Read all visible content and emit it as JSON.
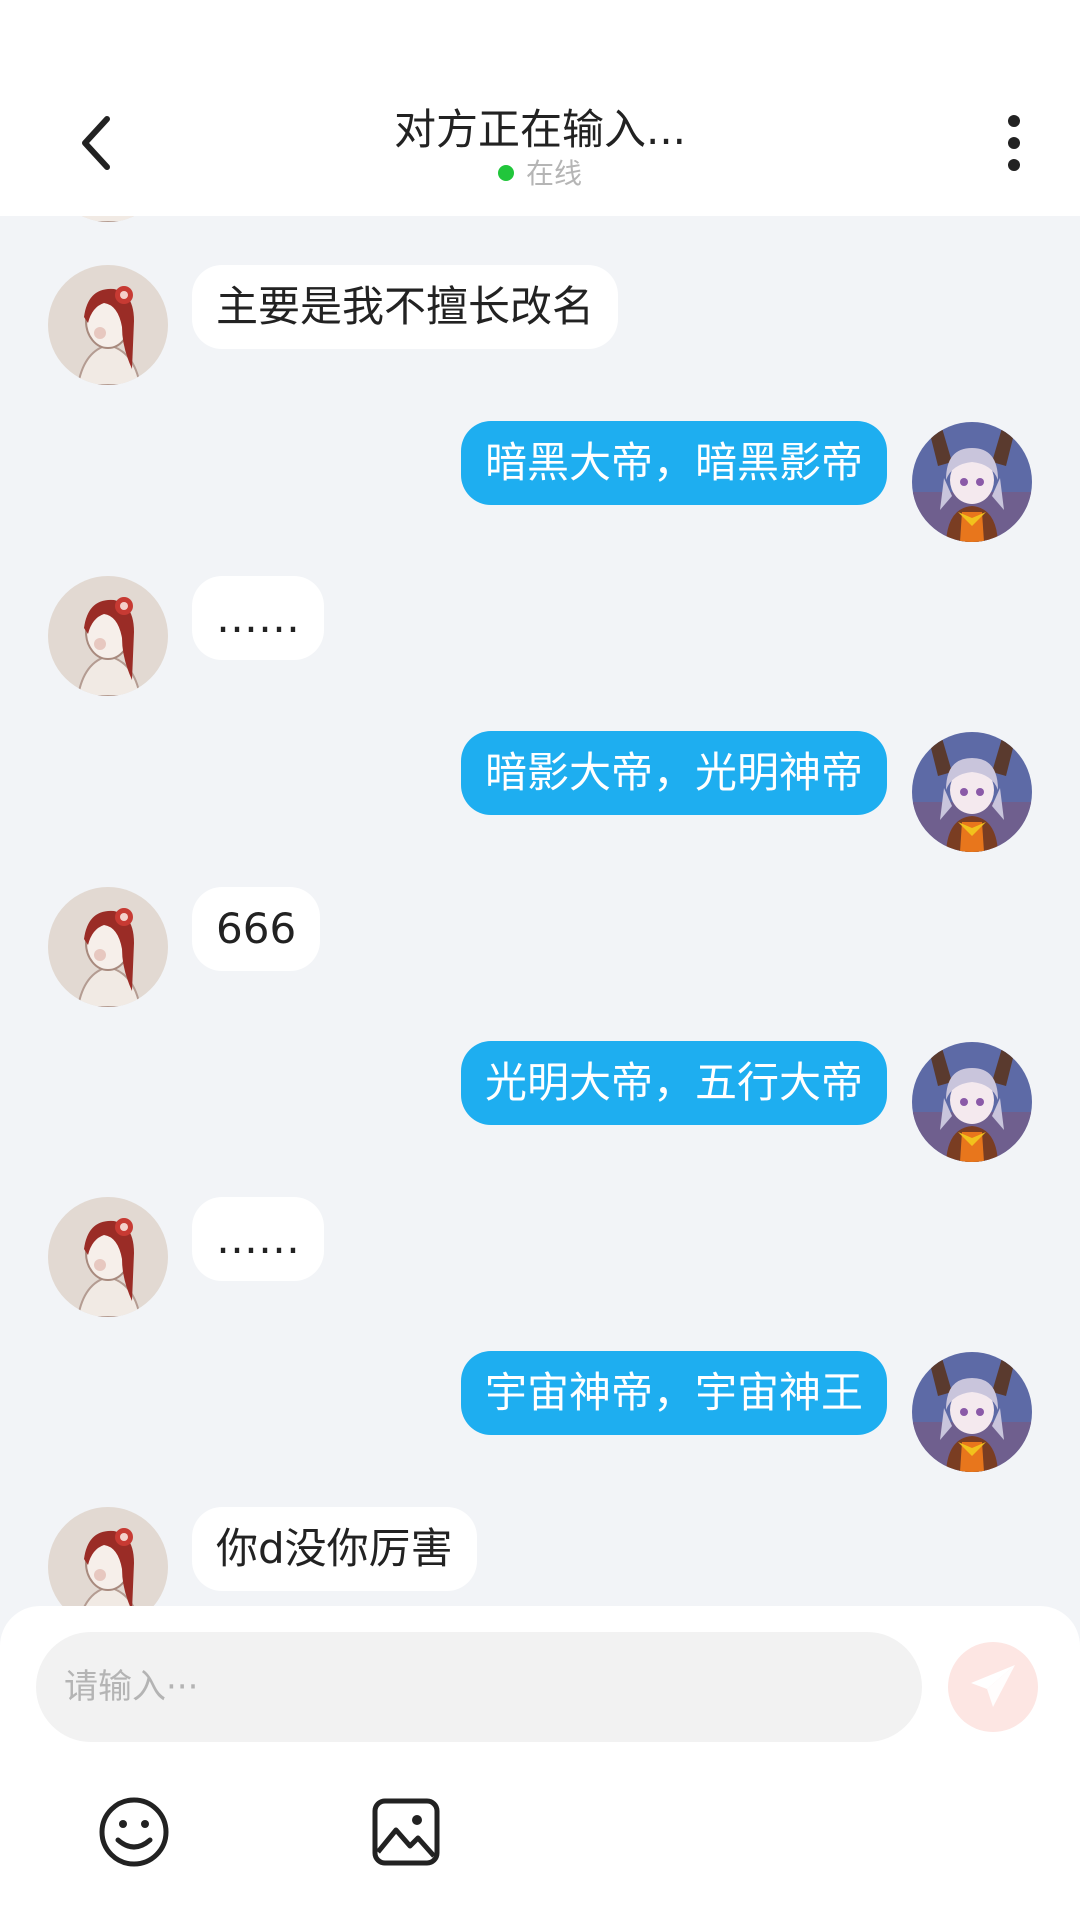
{
  "header": {
    "title": "对方正在输入...",
    "status": "在线",
    "status_color": "#21c63b"
  },
  "icons": {
    "back": "chevron-left-icon",
    "more": "more-vertical-icon",
    "send": "paper-plane-icon",
    "emoji": "smiley-icon",
    "image": "image-icon"
  },
  "messages": [
    {
      "side": "in",
      "text": "主要是我不擅长改名"
    },
    {
      "side": "out",
      "text": "暗黑大帝，暗黑影帝"
    },
    {
      "side": "in",
      "text": "……"
    },
    {
      "side": "out",
      "text": "暗影大帝，光明神帝"
    },
    {
      "side": "in",
      "text": "666"
    },
    {
      "side": "out",
      "text": "光明大帝，五行大帝"
    },
    {
      "side": "in",
      "text": "……"
    },
    {
      "side": "out",
      "text": "宇宙神帝，宇宙神王"
    },
    {
      "side": "in",
      "text": "你d没你厉害"
    }
  ],
  "composer": {
    "placeholder": "请输入···",
    "value": ""
  },
  "colors": {
    "outgoing_bubble": "#1eaef0",
    "incoming_bubble": "#ffffff",
    "background": "#f2f4f7",
    "send_button": "#f8b7ad"
  }
}
